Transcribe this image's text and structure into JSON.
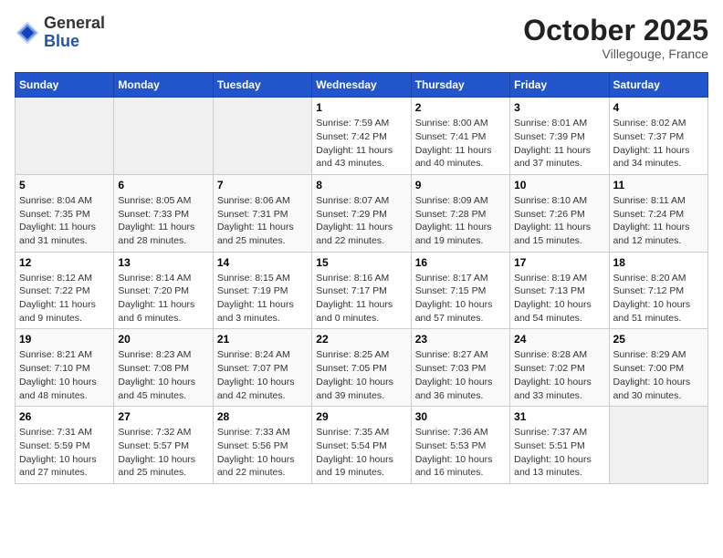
{
  "header": {
    "logo_general": "General",
    "logo_blue": "Blue",
    "month_title": "October 2025",
    "location": "Villegouge, France"
  },
  "days_of_week": [
    "Sunday",
    "Monday",
    "Tuesday",
    "Wednesday",
    "Thursday",
    "Friday",
    "Saturday"
  ],
  "weeks": [
    [
      {
        "day": "",
        "info": ""
      },
      {
        "day": "",
        "info": ""
      },
      {
        "day": "",
        "info": ""
      },
      {
        "day": "1",
        "info": "Sunrise: 7:59 AM\nSunset: 7:42 PM\nDaylight: 11 hours and 43 minutes."
      },
      {
        "day": "2",
        "info": "Sunrise: 8:00 AM\nSunset: 7:41 PM\nDaylight: 11 hours and 40 minutes."
      },
      {
        "day": "3",
        "info": "Sunrise: 8:01 AM\nSunset: 7:39 PM\nDaylight: 11 hours and 37 minutes."
      },
      {
        "day": "4",
        "info": "Sunrise: 8:02 AM\nSunset: 7:37 PM\nDaylight: 11 hours and 34 minutes."
      }
    ],
    [
      {
        "day": "5",
        "info": "Sunrise: 8:04 AM\nSunset: 7:35 PM\nDaylight: 11 hours and 31 minutes."
      },
      {
        "day": "6",
        "info": "Sunrise: 8:05 AM\nSunset: 7:33 PM\nDaylight: 11 hours and 28 minutes."
      },
      {
        "day": "7",
        "info": "Sunrise: 8:06 AM\nSunset: 7:31 PM\nDaylight: 11 hours and 25 minutes."
      },
      {
        "day": "8",
        "info": "Sunrise: 8:07 AM\nSunset: 7:29 PM\nDaylight: 11 hours and 22 minutes."
      },
      {
        "day": "9",
        "info": "Sunrise: 8:09 AM\nSunset: 7:28 PM\nDaylight: 11 hours and 19 minutes."
      },
      {
        "day": "10",
        "info": "Sunrise: 8:10 AM\nSunset: 7:26 PM\nDaylight: 11 hours and 15 minutes."
      },
      {
        "day": "11",
        "info": "Sunrise: 8:11 AM\nSunset: 7:24 PM\nDaylight: 11 hours and 12 minutes."
      }
    ],
    [
      {
        "day": "12",
        "info": "Sunrise: 8:12 AM\nSunset: 7:22 PM\nDaylight: 11 hours and 9 minutes."
      },
      {
        "day": "13",
        "info": "Sunrise: 8:14 AM\nSunset: 7:20 PM\nDaylight: 11 hours and 6 minutes."
      },
      {
        "day": "14",
        "info": "Sunrise: 8:15 AM\nSunset: 7:19 PM\nDaylight: 11 hours and 3 minutes."
      },
      {
        "day": "15",
        "info": "Sunrise: 8:16 AM\nSunset: 7:17 PM\nDaylight: 11 hours and 0 minutes."
      },
      {
        "day": "16",
        "info": "Sunrise: 8:17 AM\nSunset: 7:15 PM\nDaylight: 10 hours and 57 minutes."
      },
      {
        "day": "17",
        "info": "Sunrise: 8:19 AM\nSunset: 7:13 PM\nDaylight: 10 hours and 54 minutes."
      },
      {
        "day": "18",
        "info": "Sunrise: 8:20 AM\nSunset: 7:12 PM\nDaylight: 10 hours and 51 minutes."
      }
    ],
    [
      {
        "day": "19",
        "info": "Sunrise: 8:21 AM\nSunset: 7:10 PM\nDaylight: 10 hours and 48 minutes."
      },
      {
        "day": "20",
        "info": "Sunrise: 8:23 AM\nSunset: 7:08 PM\nDaylight: 10 hours and 45 minutes."
      },
      {
        "day": "21",
        "info": "Sunrise: 8:24 AM\nSunset: 7:07 PM\nDaylight: 10 hours and 42 minutes."
      },
      {
        "day": "22",
        "info": "Sunrise: 8:25 AM\nSunset: 7:05 PM\nDaylight: 10 hours and 39 minutes."
      },
      {
        "day": "23",
        "info": "Sunrise: 8:27 AM\nSunset: 7:03 PM\nDaylight: 10 hours and 36 minutes."
      },
      {
        "day": "24",
        "info": "Sunrise: 8:28 AM\nSunset: 7:02 PM\nDaylight: 10 hours and 33 minutes."
      },
      {
        "day": "25",
        "info": "Sunrise: 8:29 AM\nSunset: 7:00 PM\nDaylight: 10 hours and 30 minutes."
      }
    ],
    [
      {
        "day": "26",
        "info": "Sunrise: 7:31 AM\nSunset: 5:59 PM\nDaylight: 10 hours and 27 minutes."
      },
      {
        "day": "27",
        "info": "Sunrise: 7:32 AM\nSunset: 5:57 PM\nDaylight: 10 hours and 25 minutes."
      },
      {
        "day": "28",
        "info": "Sunrise: 7:33 AM\nSunset: 5:56 PM\nDaylight: 10 hours and 22 minutes."
      },
      {
        "day": "29",
        "info": "Sunrise: 7:35 AM\nSunset: 5:54 PM\nDaylight: 10 hours and 19 minutes."
      },
      {
        "day": "30",
        "info": "Sunrise: 7:36 AM\nSunset: 5:53 PM\nDaylight: 10 hours and 16 minutes."
      },
      {
        "day": "31",
        "info": "Sunrise: 7:37 AM\nSunset: 5:51 PM\nDaylight: 10 hours and 13 minutes."
      },
      {
        "day": "",
        "info": ""
      }
    ]
  ]
}
